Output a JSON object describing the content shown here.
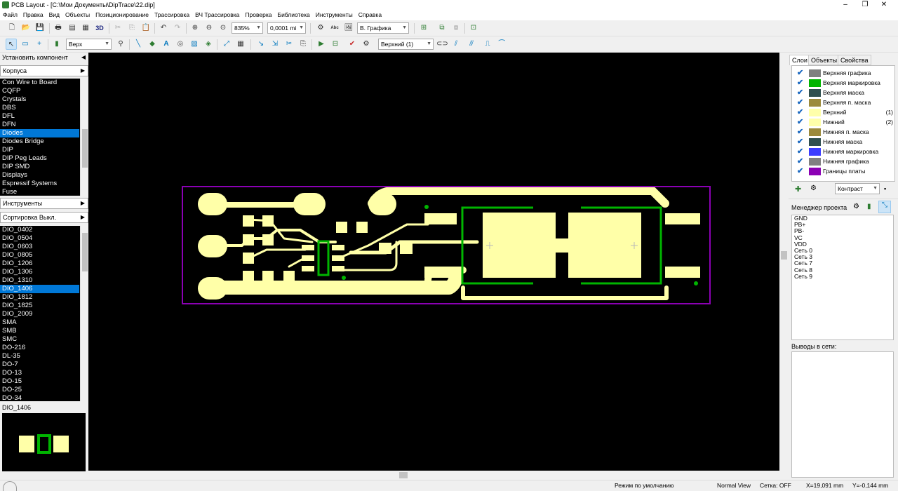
{
  "window": {
    "title": "PCB Layout - [C:\\Мои Документы\\DipTrace\\22.dip]",
    "minimize": "–",
    "maximize": "❐",
    "close": "✕"
  },
  "menu": [
    "Файл",
    "Правка",
    "Вид",
    "Объекты",
    "Позиционирование",
    "Трассировка",
    "ВЧ Трассировка",
    "Проверка",
    "Библиотека",
    "Инструменты",
    "Справка"
  ],
  "toolbar1": {
    "zoom": "835%",
    "grid": "0,0001 mi",
    "three_d": "3D",
    "layer_combo": "В. Графика"
  },
  "toolbar2": {
    "side": "Верх",
    "layer": "Верхний (1)"
  },
  "left": {
    "install_label": "Установить компонент",
    "packages_label": "Корпуса",
    "packages": [
      "Con Wire to Board",
      "CQFP",
      "Crystals",
      "DBS",
      "DFL",
      "DFN",
      "Diodes",
      "Diodes Bridge",
      "DIP",
      "DIP Peg Leads",
      "DIP SMD",
      "Displays",
      "Espressif Systems",
      "Fuse"
    ],
    "packages_selected": "Diodes",
    "tools_label": "Инструменты",
    "sort_label": "Сортировка Выкл.",
    "components": [
      "DIO_0402",
      "DIO_0504",
      "DIO_0603",
      "DIO_0805",
      "DIO_1206",
      "DIO_1306",
      "DIO_1310",
      "DIO_1406",
      "DIO_1812",
      "DIO_1825",
      "DIO_2009",
      "SMA",
      "SMB",
      "SMC",
      "DO-216",
      "DL-35",
      "DO-7",
      "DO-13",
      "DO-15",
      "DO-25",
      "DO-34"
    ],
    "components_selected": "DIO_1406",
    "preview_label": "DIO_1406"
  },
  "right": {
    "tabs": [
      "Слои",
      "Объекты",
      "Свойства"
    ],
    "layers": [
      {
        "name": "Верхняя графика",
        "color": "#808080",
        "index": ""
      },
      {
        "name": "Верхняя маркировка",
        "color": "#00b400",
        "index": ""
      },
      {
        "name": "Верхняя маска",
        "color": "#2f4f4f",
        "index": ""
      },
      {
        "name": "Верхняя п. маска",
        "color": "#9c8a3c",
        "index": ""
      },
      {
        "name": "Верхний",
        "color": "#ffffaa",
        "index": "(1)"
      },
      {
        "name": "Нижний",
        "color": "#ffffaa",
        "index": "(2)"
      },
      {
        "name": "Нижняя п. маска",
        "color": "#9c8a3c",
        "index": ""
      },
      {
        "name": "Нижняя маска",
        "color": "#2f4f4f",
        "index": ""
      },
      {
        "name": "Нижняя маркировка",
        "color": "#3c3cff",
        "index": ""
      },
      {
        "name": "Нижняя графика",
        "color": "#808080",
        "index": ""
      },
      {
        "name": "Границы платы",
        "color": "#8b00b4",
        "index": ""
      }
    ],
    "contrast": "Контраст",
    "project_manager": "Менеджер проекта",
    "nets": [
      "GND",
      "PB+",
      "PB-",
      "VC",
      "VDD",
      "Сеть 0",
      "Сеть 3",
      "Сеть 7",
      "Сеть 8",
      "Сеть 9"
    ],
    "net_pins_label": "Выводы в сети:"
  },
  "status": {
    "mode": "Режим по умолчанию",
    "view": "Normal View",
    "grid": "Сетка: OFF",
    "x": "X=19,091 mm",
    "y": "Y=-0,144 mm"
  },
  "colors": {
    "copper": "#ffffa8",
    "silk": "#00b400",
    "outline": "#8b00b4",
    "canvas": "#000000",
    "select": "#0078d7"
  }
}
